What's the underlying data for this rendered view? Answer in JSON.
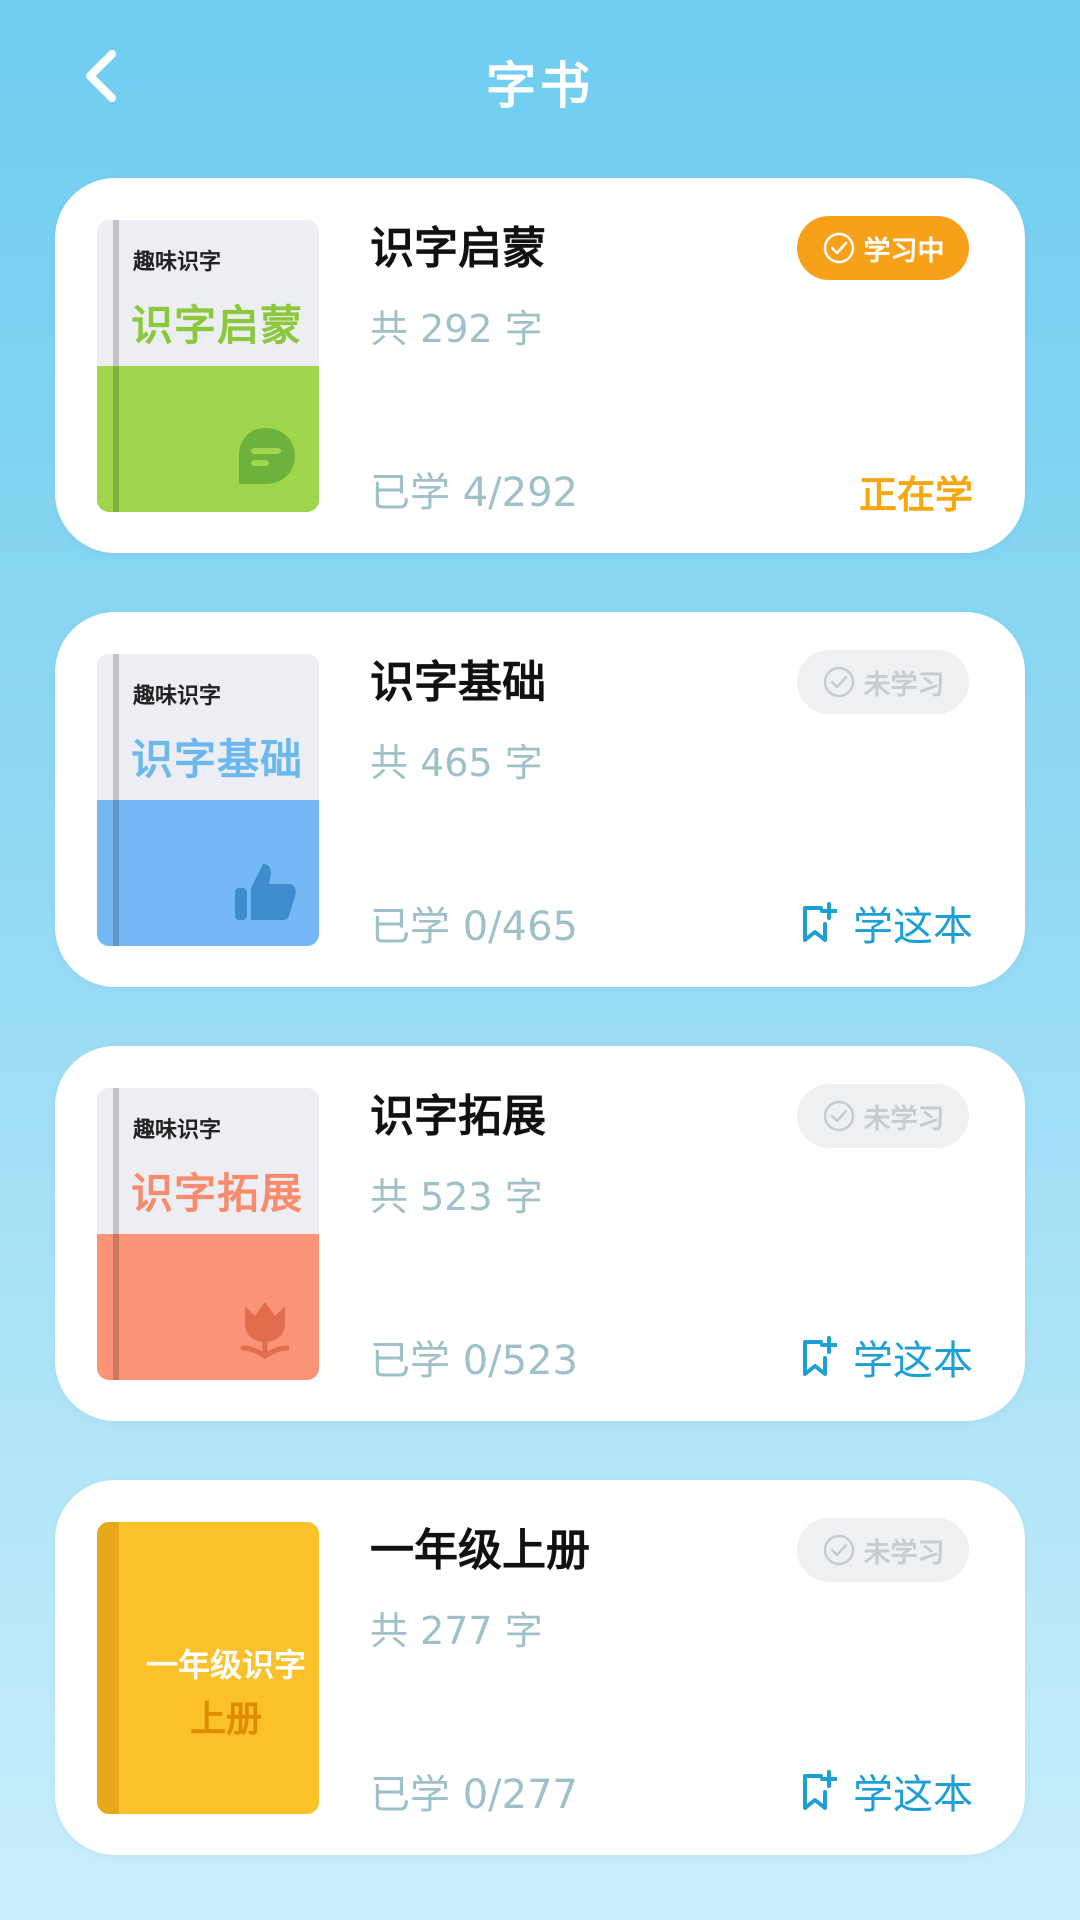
{
  "header": {
    "title": "字书"
  },
  "books": [
    {
      "cover_small": "趣味识字",
      "cover_title": "识字启蒙",
      "cover_title_color": "#8bc83c",
      "cover_bottom_color": "#a0d64d",
      "cover_icon": "chat-bubble-icon",
      "title": "识字启蒙",
      "count": "共 292 字",
      "learned": "已学 4/292",
      "badge": "学习中",
      "status": "正在学"
    },
    {
      "cover_small": "趣味识字",
      "cover_title": "识字基础",
      "cover_title_color": "#6bb8ef",
      "cover_bottom_color": "#74b8f5",
      "cover_icon": "thumbs-up-icon",
      "title": "识字基础",
      "count": "共 465 字",
      "learned": "已学 0/465",
      "badge": "未学习",
      "action": "学这本"
    },
    {
      "cover_small": "趣味识字",
      "cover_title": "识字拓展",
      "cover_title_color": "#f78b6b",
      "cover_bottom_color": "#fb9377",
      "cover_icon": "flower-icon",
      "title": "识字拓展",
      "count": "共 523 字",
      "learned": "已学 0/523",
      "badge": "未学习",
      "action": "学这本"
    },
    {
      "cover_line1": "一年级识字",
      "cover_line2": "上册",
      "cover_bg_color": "#fbc129",
      "title": "一年级上册",
      "count": "共 277 字",
      "learned": "已学 0/277",
      "badge": "未学习",
      "action": "学这本"
    }
  ],
  "colors": {
    "active_badge": "#f7a11a",
    "inactive_badge": "#eff0f2",
    "action_blue": "#1d9fd6",
    "status_orange": "#f5a70f"
  }
}
